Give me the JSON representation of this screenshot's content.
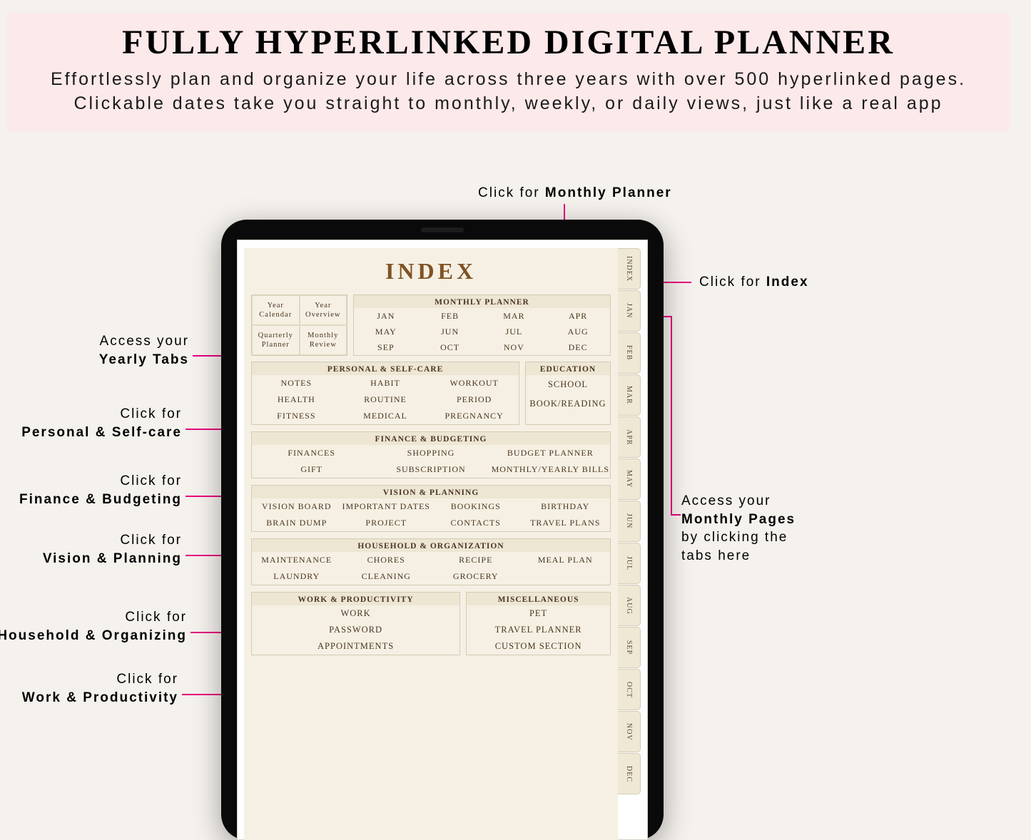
{
  "banner": {
    "title": "FULLY HYPERLINKED DIGITAL PLANNER",
    "subtitle": "Effortlessly plan and organize your life across three years with over 500 hyperlinked pages. Clickable dates take you straight to monthly, weekly, or daily views, just like a real app"
  },
  "callouts": {
    "monthly_top_pre": "Click for ",
    "monthly_top_b": "Monthly Planner",
    "index_right_pre": "Click for ",
    "index_right_b": "Index",
    "pages_right_pre": "Access your",
    "pages_right_b": "Monthly Pages",
    "pages_right_post": "by clicking the tabs here",
    "yearly_pre": "Access your",
    "yearly_b": "Yearly Tabs",
    "pc_pre": "Click for",
    "pc_b": "Personal & Self-care",
    "fb_pre": "Click for",
    "fb_b": "Finance & Budgeting",
    "vp_pre": "Click for",
    "vp_b": "Vision & Planning",
    "ho_pre": "Click for",
    "ho_b": "Household & Organizing",
    "wp_pre": "Click for",
    "wp_b": "Work & Productivity"
  },
  "page": {
    "title": "INDEX",
    "yearly": [
      "Year Calendar",
      "Year Overview",
      "Quarterly Planner",
      "Monthly Review"
    ],
    "monthly_hdr": "MONTHLY PLANNER",
    "months": [
      "JAN",
      "FEB",
      "MAR",
      "APR",
      "MAY",
      "JUN",
      "JUL",
      "AUG",
      "SEP",
      "OCT",
      "NOV",
      "DEC"
    ],
    "personal_hdr": "PERSONAL & SELF-CARE",
    "personal": [
      "NOTES",
      "HABIT",
      "WORKOUT",
      "HEALTH",
      "ROUTINE",
      "PERIOD",
      "FITNESS",
      "MEDICAL",
      "PREGNANCY"
    ],
    "edu_hdr": "EDUCATION",
    "edu": [
      "SCHOOL",
      "BOOK/READING"
    ],
    "finance_hdr": "FINANCE & BUDGETING",
    "finance": [
      "FINANCES",
      "SHOPPING",
      "BUDGET PLANNER",
      "GIFT",
      "SUBSCRIPTION",
      "MONTHLY/YEARLY BILLS"
    ],
    "vision_hdr": "VISION & PLANNING",
    "vision": [
      "VISION BOARD",
      "IMPORTANT DATES",
      "BOOKINGS",
      "BIRTHDAY",
      "BRAIN DUMP",
      "PROJECT",
      "CONTACTS",
      "TRAVEL PLANS"
    ],
    "house_hdr": "HOUSEHOLD & ORGANIZATION",
    "house": [
      "MAINTENANCE",
      "CHORES",
      "RECIPE",
      "MEAL PLAN",
      "LAUNDRY",
      "CLEANING",
      "GROCERY",
      ""
    ],
    "work_hdr": "WORK & PRODUCTIVITY",
    "work": [
      "WORK",
      "PASSWORD",
      "APPOINTMENTS"
    ],
    "misc_hdr": "MISCELLANEOUS",
    "misc": [
      "PET",
      "TRAVEL PLANNER",
      "CUSTOM SECTION"
    ]
  },
  "sidetabs": [
    "INDEX",
    "JAN",
    "FEB",
    "MAR",
    "APR",
    "MAY",
    "JUN",
    "JUL",
    "AUG",
    "SEP",
    "OCT",
    "NOV",
    "DEC"
  ]
}
